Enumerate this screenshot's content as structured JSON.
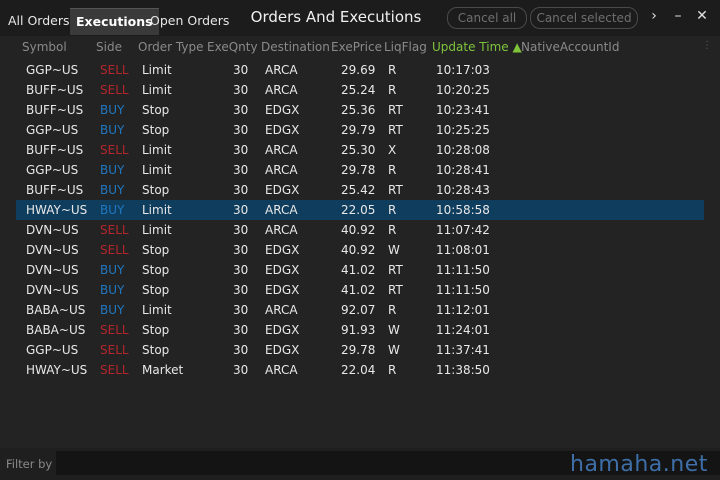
{
  "tabs": [
    "All Orders",
    "Executions",
    "Open Orders"
  ],
  "window_title": "Orders And Executions",
  "toolbar": {
    "cancel_all": "Cancel all",
    "cancel_selected": "Cancel selected",
    "more_icon": "chevron-right-icon",
    "minimize_icon": "minimize-icon",
    "close_icon": "close-icon"
  },
  "columns": [
    "Symbol",
    "Side",
    "Order Type",
    "ExeQnty",
    "Destination",
    "ExePrice",
    "LiqFlag",
    "Update Time ▲",
    "NativeAccountId"
  ],
  "rows": [
    {
      "symbol": "GGP~US",
      "side": "SELL",
      "type": "Limit",
      "qty": "30",
      "dest": "ARCA",
      "price": "29.69",
      "liq": "R",
      "time": "10:17:03"
    },
    {
      "symbol": "BUFF~US",
      "side": "SELL",
      "type": "Limit",
      "qty": "30",
      "dest": "ARCA",
      "price": "25.24",
      "liq": "R",
      "time": "10:20:25"
    },
    {
      "symbol": "BUFF~US",
      "side": "BUY",
      "type": "Stop",
      "qty": "30",
      "dest": "EDGX",
      "price": "25.36",
      "liq": "RT",
      "time": "10:23:41"
    },
    {
      "symbol": "GGP~US",
      "side": "BUY",
      "type": "Stop",
      "qty": "30",
      "dest": "EDGX",
      "price": "29.79",
      "liq": "RT",
      "time": "10:25:25"
    },
    {
      "symbol": "BUFF~US",
      "side": "SELL",
      "type": "Limit",
      "qty": "30",
      "dest": "ARCA",
      "price": "25.30",
      "liq": "X",
      "time": "10:28:08"
    },
    {
      "symbol": "GGP~US",
      "side": "BUY",
      "type": "Limit",
      "qty": "30",
      "dest": "ARCA",
      "price": "29.78",
      "liq": "R",
      "time": "10:28:41"
    },
    {
      "symbol": "BUFF~US",
      "side": "BUY",
      "type": "Stop",
      "qty": "30",
      "dest": "EDGX",
      "price": "25.42",
      "liq": "RT",
      "time": "10:28:43"
    },
    {
      "symbol": "HWAY~US",
      "side": "BUY",
      "type": "Limit",
      "qty": "30",
      "dest": "ARCA",
      "price": "22.05",
      "liq": "R",
      "time": "10:58:58",
      "selected": true
    },
    {
      "symbol": "DVN~US",
      "side": "SELL",
      "type": "Limit",
      "qty": "30",
      "dest": "ARCA",
      "price": "40.92",
      "liq": "R",
      "time": "11:07:42"
    },
    {
      "symbol": "DVN~US",
      "side": "SELL",
      "type": "Stop",
      "qty": "30",
      "dest": "EDGX",
      "price": "40.92",
      "liq": "W",
      "time": "11:08:01"
    },
    {
      "symbol": "DVN~US",
      "side": "BUY",
      "type": "Stop",
      "qty": "30",
      "dest": "EDGX",
      "price": "41.02",
      "liq": "RT",
      "time": "11:11:50"
    },
    {
      "symbol": "DVN~US",
      "side": "BUY",
      "type": "Stop",
      "qty": "30",
      "dest": "EDGX",
      "price": "41.02",
      "liq": "RT",
      "time": "11:11:50"
    },
    {
      "symbol": "BABA~US",
      "side": "BUY",
      "type": "Limit",
      "qty": "30",
      "dest": "ARCA",
      "price": "92.07",
      "liq": "R",
      "time": "11:12:01"
    },
    {
      "symbol": "BABA~US",
      "side": "SELL",
      "type": "Stop",
      "qty": "30",
      "dest": "EDGX",
      "price": "91.93",
      "liq": "W",
      "time": "11:24:01"
    },
    {
      "symbol": "GGP~US",
      "side": "SELL",
      "type": "Stop",
      "qty": "30",
      "dest": "EDGX",
      "price": "29.78",
      "liq": "W",
      "time": "11:37:41"
    },
    {
      "symbol": "HWAY~US",
      "side": "SELL",
      "type": "Market",
      "qty": "30",
      "dest": "ARCA",
      "price": "22.04",
      "liq": "R",
      "time": "11:38:50"
    }
  ],
  "filter": {
    "label": "Filter by",
    "value": ""
  },
  "watermark": "hamaha.net",
  "colors": {
    "sell": "#b5252c",
    "buy": "#1f78c2",
    "selected_row": "#0f3d5e",
    "sorted_header": "#7ec43b"
  }
}
